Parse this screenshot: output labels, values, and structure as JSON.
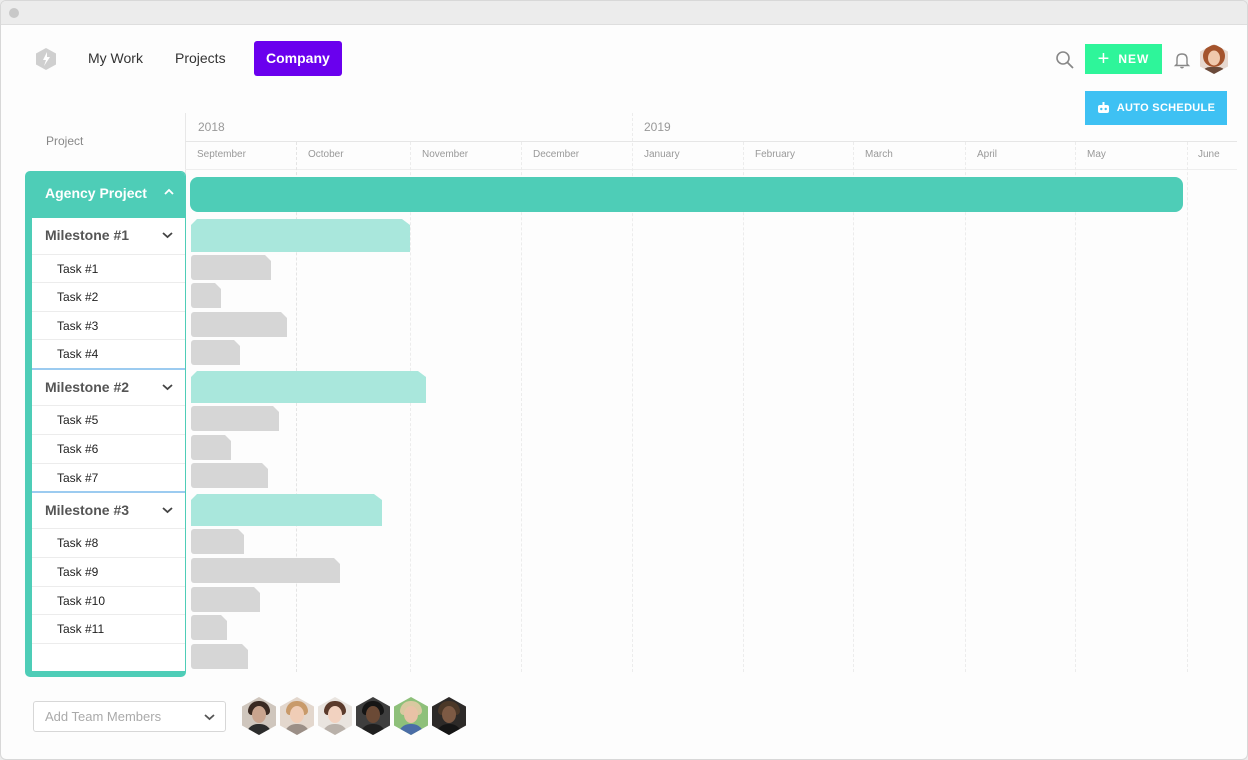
{
  "nav": {
    "items": [
      {
        "label": "My Work"
      },
      {
        "label": "Projects"
      },
      {
        "label": "Company"
      }
    ],
    "new_label": "NEW",
    "auto_schedule_label": "AUTO SCHEDULE",
    "icons": [
      "logo-icon",
      "search-icon",
      "plus-icon",
      "bell-icon",
      "robot-icon"
    ]
  },
  "timeline": {
    "column_label": "Project",
    "years": [
      "2018",
      "2019"
    ],
    "months": [
      "September",
      "October",
      "November",
      "December",
      "January",
      "February",
      "March",
      "April",
      "May",
      "June"
    ]
  },
  "project": {
    "name": "Agency Project",
    "milestones": [
      {
        "name": "Milestone #1",
        "tasks": [
          "Task #1",
          "Task #2",
          "Task #3",
          "Task #4"
        ]
      },
      {
        "name": "Milestone #2",
        "tasks": [
          "Task #5",
          "Task #6",
          "Task #7"
        ]
      },
      {
        "name": "Milestone #3",
        "tasks": [
          "Task #8",
          "Task #9",
          "Task #10",
          "Task #11"
        ]
      }
    ]
  },
  "footer": {
    "add_members_placeholder": "Add Team Members",
    "team_member_count": 6
  },
  "colors": {
    "accent_purple": "#6a00ee",
    "new_green": "#2ef59a",
    "auto_blue": "#3ec1f3",
    "project_teal": "#4ecdb7",
    "milestone_teal_light": "#a9e7dc",
    "task_gray": "#d6d6d6"
  }
}
